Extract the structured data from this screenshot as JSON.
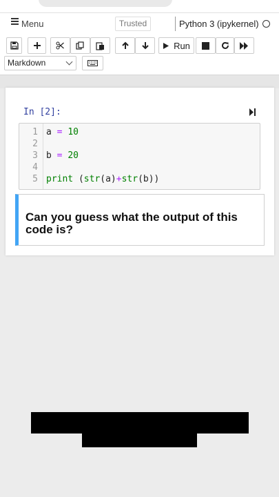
{
  "menubar": {
    "menu_label": "Menu",
    "trusted_label": "Trusted",
    "kernel_name": "Python 3 (ipykernel)"
  },
  "toolbar": {
    "run_label": "Run",
    "cell_type_value": "Markdown",
    "buttons": [
      "save-icon",
      "plus-icon",
      "scissors-icon",
      "copy-icon",
      "paste-icon",
      "arrow-up-icon",
      "arrow-down-icon",
      "play-icon",
      "stop-icon",
      "restart-icon",
      "fast-forward-icon",
      "keyboard-icon"
    ]
  },
  "code_cell": {
    "prompt": "In [2]:",
    "lines": [
      {
        "number": "1",
        "text": "a = 10"
      },
      {
        "number": "2",
        "text": ""
      },
      {
        "number": "3",
        "text": "b = 20"
      },
      {
        "number": "4",
        "text": ""
      },
      {
        "number": "5",
        "text": "print (str(a)+str(b))"
      }
    ]
  },
  "markdown_cell": {
    "text": "Can you guess what the output of this code is?"
  },
  "colors": {
    "accent": "#42a5f5",
    "prompt": "#303f9f",
    "keyword": "#008000",
    "operator": "#aa22ff"
  }
}
